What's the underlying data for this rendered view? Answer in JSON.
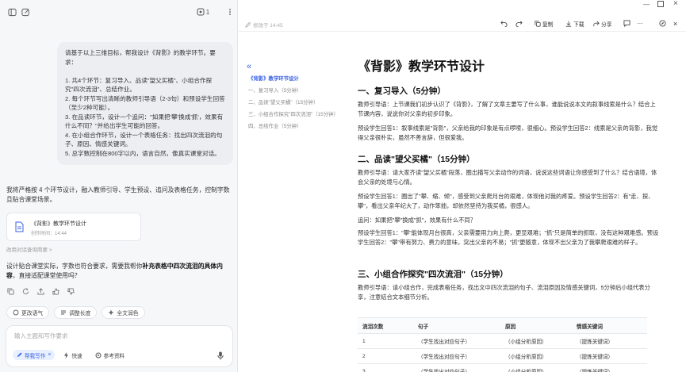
{
  "left_top": {
    "count": "1"
  },
  "chat": {
    "user_message": "请基于以上三维目标，帮我设计《背影》的教学环节。要求：\n\n1. 共4个环节：复习导入、品读\"望父买橘\"、小组合作探究\"四次流泪\"、总结作业。\n2. 每个环节写出清晰的教师引导语（2-3句）和预设学生回答（至少2种可能）。\n3. 在品读环节，设计一个追问：\"如果把'攀'换成'抓'，效果有什么不同？\"并给出学生可能的回答。\n4. 在小组合作环节，设计一个表格任务：找出四次流泪的句子、原因、情感关键词。\n5. 总字数控制在800字以内，语言自然，像真实课堂对话。",
    "reply_intro": "我将严格按 4 个环节设计，融入教师引导、学生预设、追问及表格任务，控制字数且贴合课堂场景。",
    "doc_card": {
      "title": "《背影》教学环节设计",
      "time": "创作时间：14:44"
    },
    "change_note": "改用对话查询简要 >",
    "followup_prefix": "设计贴合课堂实际，字数也符合要求，需要我帮你",
    "followup_bold": "补充表格中四次流泪的具体内容",
    "followup_suffix": "，直接适配课堂使用吗？",
    "quick_actions": [
      "更改语气",
      "调整长度",
      "全文润色"
    ],
    "input_placeholder": "输入主题和写作要求",
    "tools": [
      "帮我写作",
      "快速",
      "参考资料"
    ]
  },
  "doc": {
    "saved_time": "修改于 14:45",
    "toolbar": [
      "复制",
      "下载",
      "分享"
    ],
    "toc": [
      "《背影》教学环节设计",
      "一、复习导入（5分钟）",
      "二、品读\"望父买橘\"（15分钟）",
      "三、小组合作探究\"四次流泪\"（15分钟）",
      "四、总结作业（5分钟）"
    ],
    "title": "《背影》教学环节设计",
    "sections": [
      {
        "heading": "一、复习导入（5分钟）",
        "paras": [
          "教师引导语：上节课我们初步认识了《背影》，了解了文章主要写了什么事，谁能说说本文的叙事线索是什么？结合上节课内容，说说你对父亲的初步印象。",
          "预设学生回答1：叙事线索是\"背影\"，父亲给我的印象是有点啰嗦，很细心。预设学生回答2：线索是父亲的背影，我觉得父亲很朴实，虽然不善言辞，但很爱我。"
        ]
      },
      {
        "heading": "二、品读\"望父买橘\"（15分钟）",
        "paras": [
          "教师引导语：请大家齐读\"望父买橘\"段落，圈出描写父亲动作的词语，说说这些词语让你感受到了什么？结合语境，体会父亲的处境与心情。",
          "预设学生回答1：圈出了\"攀、缩、倾\"，感受到父亲爬月台的艰难，体现他对我的疼爱。预设学生回答2：有\"走、探、攀\"，看出父亲年纪大了，动作笨拙，却依然坚持为我买橘，很感人。",
          "追问：如果把\"攀\"换成\"抓\"，效果有什么不同？",
          "预设学生回答1：\"攀\"能体现月台很高，父亲需要用力向上爬，更显艰难；\"抓\"只是简单的抓取，没有这种艰难感。预设学生回答2：\"攀\"带有努力、费力的意味，突出父亲的不易；\"抓\"更随意，体现不出父亲为了我攀爬艰难的样子。"
        ]
      },
      {
        "heading": "三、小组合作探究\"四次流泪\"（15分钟）",
        "paras": [
          "教师引导语：请小组合作，完成表格任务，找出文中四次流泪的句子、流泪原因及情感关键词，5分钟后小组代表分享，注意结合文本细节分析。"
        ]
      }
    ],
    "table": {
      "headers": [
        "流泪次数",
        "句子",
        "原因",
        "情感关键词"
      ],
      "rows": [
        [
          "1",
          "（学生找出对应句子）",
          "（小组分析原因）",
          "（提炼关键词）"
        ],
        [
          "2",
          "（学生找出对应句子）",
          "（小组分析原因）",
          "（提炼关键词）"
        ],
        [
          "3",
          "（学生找出对应句子）",
          "（小组分析原因）",
          "（提炼关键词）"
        ]
      ]
    }
  },
  "colors": {
    "accent": "#3a62e6",
    "panel_bg": "#f6f7f9",
    "bubble_bg": "#eceef2"
  }
}
